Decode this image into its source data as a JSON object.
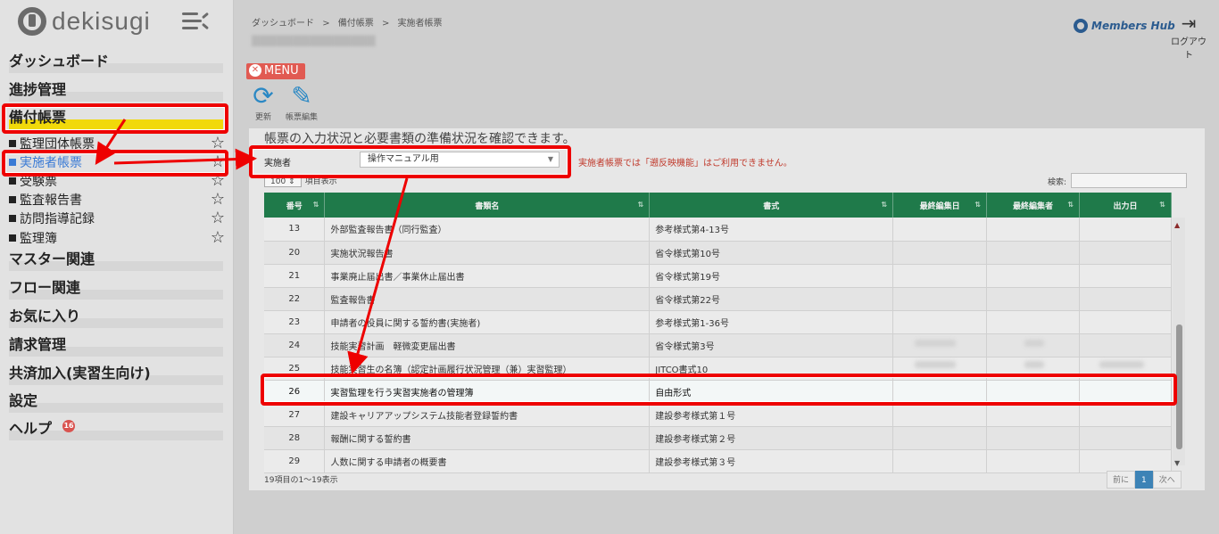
{
  "brand": {
    "logo_text": "dekisugi"
  },
  "sidebar": {
    "nav": [
      {
        "label": "ダッシュボード"
      },
      {
        "label": "進捗管理"
      },
      {
        "label": "備付帳票"
      },
      {
        "label": "マスター関連"
      },
      {
        "label": "フロー関連"
      },
      {
        "label": "お気に入り"
      },
      {
        "label": "請求管理"
      },
      {
        "label": "共済加入(実習生向け)"
      },
      {
        "label": "設定"
      },
      {
        "label": "ヘルプ",
        "badge": "16"
      }
    ],
    "sub_items": [
      {
        "label": "監理団体帳票"
      },
      {
        "label": "実施者帳票"
      },
      {
        "label": "受験票"
      },
      {
        "label": "監査報告書"
      },
      {
        "label": "訪問指導記録"
      },
      {
        "label": "監理簿"
      }
    ]
  },
  "header": {
    "breadcrumb": [
      "ダッシュボード",
      ">",
      "備付帳票",
      ">",
      "実施者帳票"
    ],
    "members_hub": "Members Hub",
    "logout": "ログアウト"
  },
  "toolbar": {
    "menu_label": "MENU",
    "refresh_label": "更新",
    "edit_label": "帳票編集"
  },
  "panel": {
    "description": "帳票の入力状況と必要書類の準備状況を確認できます。",
    "filter_label": "実施者",
    "filter_value": "操作マニュアル用",
    "warning": "実施者帳票では「遡反映機能」はご利用できません。",
    "length_value": "100",
    "length_suffix": "項目表示",
    "search_label": "検索:",
    "info": "19項目の1～19表示",
    "pager": {
      "prev": "前に",
      "page": "1",
      "next": "次へ"
    }
  },
  "table": {
    "headers": [
      "番号",
      "書類名",
      "書式",
      "最終編集日",
      "最終編集者",
      "出力日"
    ],
    "rows": [
      {
        "num": "13",
        "name": "外部監査報告書（同行監査）",
        "format": "参考様式第4-13号"
      },
      {
        "num": "20",
        "name": "実施状況報告書",
        "format": "省令様式第10号"
      },
      {
        "num": "21",
        "name": "事業廃止届出書／事業休止届出書",
        "format": "省令様式第19号"
      },
      {
        "num": "22",
        "name": "監査報告書",
        "format": "省令様式第22号"
      },
      {
        "num": "23",
        "name": "申請者の役員に関する誓約書(実施者)",
        "format": "参考様式第1-36号"
      },
      {
        "num": "24",
        "name": "技能実習計画　軽微変更届出書",
        "format": "省令様式第3号"
      },
      {
        "num": "25",
        "name": "技能実習生の名簿（認定計画履行状況管理（兼）実習監理）",
        "format": "JITCO書式10"
      },
      {
        "num": "26",
        "name": "実習監理を行う実習実施者の管理簿",
        "format": "自由形式"
      },
      {
        "num": "27",
        "name": "建設キャリアアップシステム技能者登録誓約書",
        "format": "建設参考様式第１号"
      },
      {
        "num": "28",
        "name": "報酬に関する誓約書",
        "format": "建設参考様式第２号"
      },
      {
        "num": "29",
        "name": "人数に関する申請者の概要書",
        "format": "建設参考様式第３号"
      }
    ]
  },
  "colors": {
    "annotation_red": "#ee0000",
    "header_green": "#1f7a4a",
    "highlight_yellow": "#f1d90a",
    "active_link": "#3a7bd5"
  }
}
